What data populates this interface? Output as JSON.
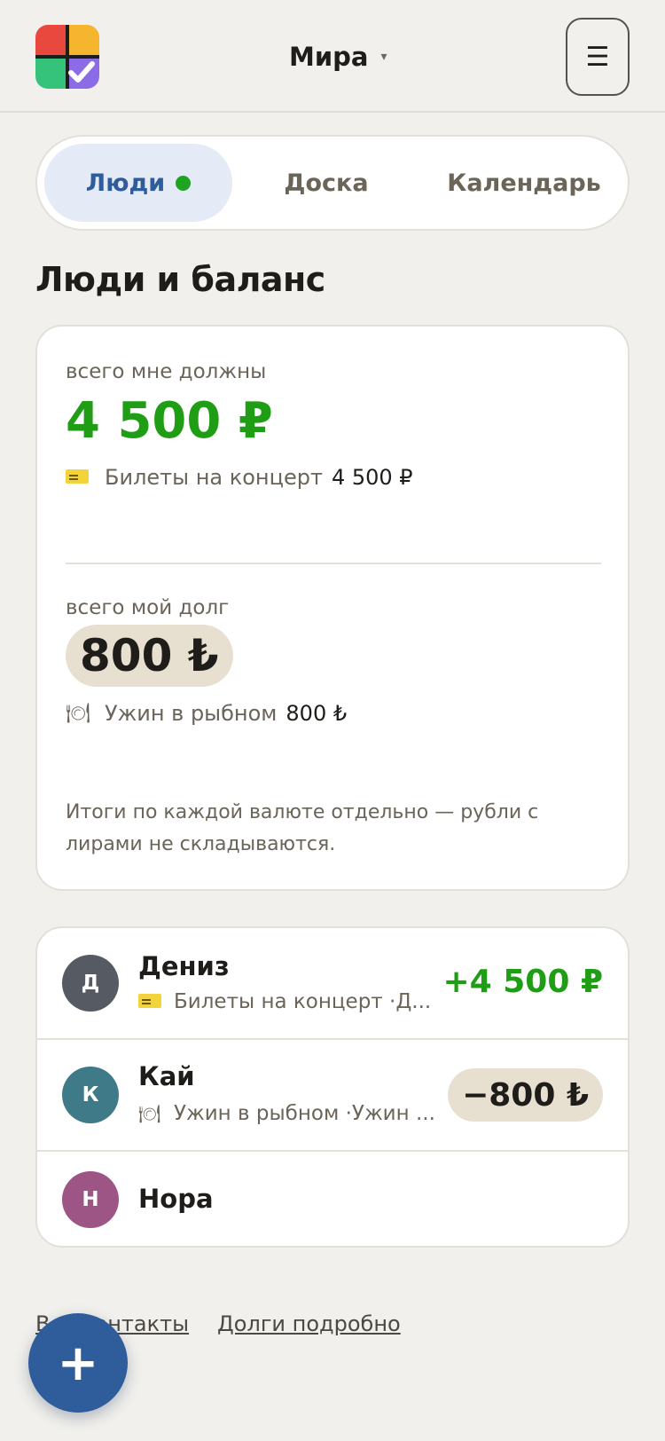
{
  "header": {
    "user_name": "Мира",
    "caret": "▾",
    "menu_icon": "☰"
  },
  "tabs": [
    {
      "label": "Люди",
      "active": true,
      "has_dot": true
    },
    {
      "label": "Доска",
      "active": false
    },
    {
      "label": "Календарь",
      "active": false
    }
  ],
  "page_title": "Люди и баланс",
  "balance": {
    "owed_label": "всего мне должны",
    "owed_amount": "4 500 ₽",
    "owed_item": {
      "icon": "ticket-icon",
      "title": "Билеты на концерт",
      "amount": "4 500 ₽"
    },
    "debt_label": "всего мой долг",
    "debt_amount": "800 ₺",
    "debt_item": {
      "icon": "plate-icon",
      "icon_glyph": "🍽",
      "title": "Ужин в рыбном",
      "amount": "800 ₺"
    },
    "note": "Итоги по каждой валюте отдельно — рубли с лирами не складываются."
  },
  "people": [
    {
      "initial": "Д",
      "name": "Дениз",
      "avatar_color": "#565a62",
      "sub_icon": "ticket-icon",
      "sub": "Билеты на концерт ·Д...",
      "amount": "+4 500 ₽",
      "type": "positive"
    },
    {
      "initial": "К",
      "name": "Кай",
      "avatar_color": "#3e7a87",
      "sub_icon": "plate-icon",
      "sub_glyph": "🍽",
      "sub": "Ужин в рыбном ·Ужин ...",
      "amount": "−800 ₺",
      "type": "negative"
    },
    {
      "initial": "Н",
      "name": "Нора",
      "avatar_color": "#9c5585",
      "type": "none"
    }
  ],
  "links": {
    "contacts": "Все контакты",
    "debts": "Долги подробно"
  },
  "fab_label": "+",
  "colors": {
    "accent": "#2f5d9c",
    "positive": "#1f9d14",
    "pill": "#e7e0d1",
    "background": "#f1f0ec"
  }
}
